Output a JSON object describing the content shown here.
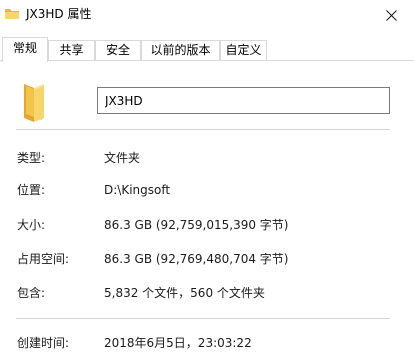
{
  "window": {
    "title": "JX3HD 属性",
    "close_icon": "close-icon",
    "folder_icon": "folder-icon",
    "accent_folder_color": "#f3c94b"
  },
  "tabs": [
    {
      "label": "常规",
      "active": true
    },
    {
      "label": "共享",
      "active": false
    },
    {
      "label": "安全",
      "active": false
    },
    {
      "label": "以前的版本",
      "active": false
    },
    {
      "label": "自定义",
      "active": false
    }
  ],
  "general": {
    "name_value": "JX3HD",
    "rows": [
      {
        "label": "类型:",
        "value": "文件夹"
      },
      {
        "label": "位置:",
        "value": "D:\\Kingsoft"
      },
      {
        "label": "大小:",
        "value": "86.3 GB (92,759,015,390 字节)"
      },
      {
        "label": "占用空间:",
        "value": "86.3 GB (92,769,480,704 字节)"
      },
      {
        "label": "包含:",
        "value": "5,832 个文件，560 个文件夹"
      },
      {
        "label": "创建时间:",
        "value": "2018年6月5日，23:03:22"
      }
    ]
  }
}
